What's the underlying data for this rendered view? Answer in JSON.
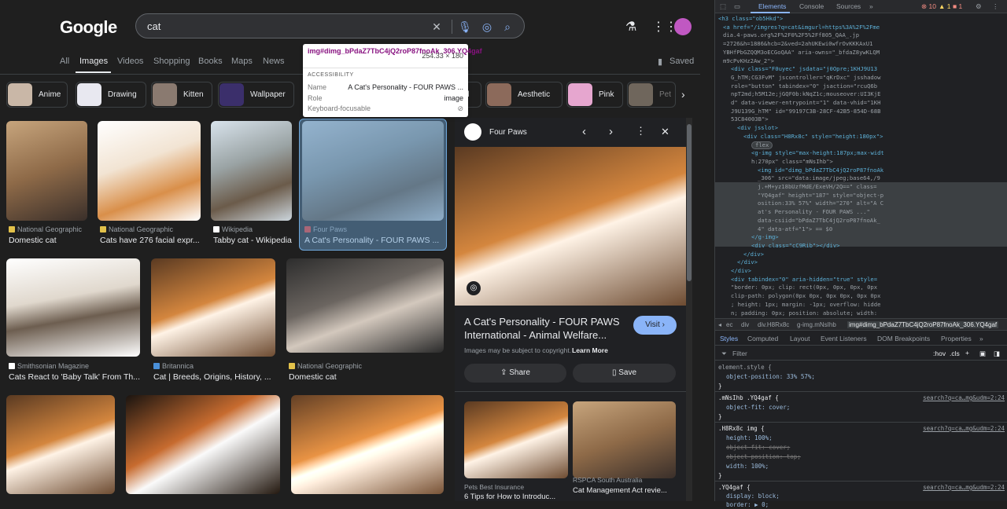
{
  "header": {
    "logo": "Google",
    "search_query": "cat",
    "saved_label": "Saved"
  },
  "tabs": [
    "All",
    "Images",
    "Videos",
    "Shopping",
    "Books",
    "Maps",
    "News"
  ],
  "chips": [
    "Anime",
    "Drawing",
    "Kitten",
    "Wallpaper",
    "rl",
    "Aesthetic",
    "Pink",
    "Pet"
  ],
  "results": [
    {
      "source": "National Geographic",
      "title": "Domestic cat"
    },
    {
      "source": "National Geographic",
      "title": "Cats have 276 facial expr..."
    },
    {
      "source": "Wikipedia",
      "title": "Tabby cat - Wikipedia"
    },
    {
      "source": "Four Paws",
      "title": "A Cat's Personality - FOUR PAWS ..."
    },
    {
      "source": "Smithsonian Magazine",
      "title": "Cats React to 'Baby Talk' From Th..."
    },
    {
      "source": "Britannica",
      "title": "Cat | Breeds, Origins, History, ..."
    },
    {
      "source": "National Geographic",
      "title": "Domestic cat"
    }
  ],
  "panel": {
    "source": "Four Paws",
    "title": "A Cat's Personality - FOUR PAWS International - Animal Welfare...",
    "visit_label": "Visit",
    "copyright": "Images may be subject to copyright.",
    "learn_more": "Learn More",
    "share_label": "Share",
    "save_label": "Save",
    "related": [
      {
        "source": "Pets Best Insurance",
        "title": "6 Tips for How to Introduc..."
      },
      {
        "source": "RSPCA South Australia",
        "title": "Cat Management Act revie..."
      }
    ]
  },
  "tooltip": {
    "selector": "img#dimg_bPdaZ7TbC4jQ2roP87fnoAk_306.YQ4gaf",
    "size": "254.33 × 180",
    "heading": "ACCESSIBILITY",
    "name_label": "Name",
    "name_value": "A Cat's Personality - FOUR PAWS ...",
    "role_label": "Role",
    "role_value": "image",
    "focus_label": "Keyboard-focusable"
  },
  "devtools": {
    "tabs": [
      "Elements",
      "Console",
      "Sources"
    ],
    "errors": "10",
    "warnings": "1",
    "issues": "1",
    "crumbs": [
      "ec",
      "div",
      "div.H8Rx8c",
      "g-img.mNsIhb",
      "img#dimg_bPdaZ7TbC4jQ2roP87fnoAk_306.YQ4gaf"
    ],
    "style_tabs": [
      "Styles",
      "Computed",
      "Layout",
      "Event Listeners",
      "DOM Breakpoints",
      "Properties"
    ],
    "filter_placeholder": "Filter",
    "hov": ":hov",
    "cls": ".cls",
    "code_lines": [
      "<h3 class=\"ob5Hkd\">",
      "<a href=\"/imgres?q=cat&imgurl=https%3A%2F%2Fme",
      "dia.4-paws.org%2F%2F0%2F5%2Ff805_QAA_.jp",
      "=2726&h=1886&hcb=2&ved=2ahUKEwi0wfrOvKKKAxU1",
      "YBHfPbGZQQM3oECGoQAA\" aria-owns=\"_bfdaZ8ywKLQM",
      "m9cPvKHz2Aw_2\">",
      "<div class=\"F0uyec\" jsdata=\"j0Opre;1KHJ9U13",
      "G_hTM;CG3FvM\" jscontroller=\"qKrDxc\" jsshadow",
      "role=\"button\" tabindex=\"0\" jsaction=\"rcuQ6b",
      "npT2md;h5M12e;jGQF0b:kNqZ1c;mouseover:UI3KjE",
      "d\" data-viewer-entrypoint=\"1\" data-vhid=\"1KH",
      "J9U139G_hTM\" id=\"99197C3B-28CF-42B5-854D-68B",
      "53C84003B\">",
      "<div jsslot>",
      "<div class=\"H8Rx8c\" style=\"height:180px\">",
      "flex",
      "<g-img style=\"max-height:187px;max-widt",
      "h:270px\" class=\"mNsIhb\">",
      "<img id=\"dimg_bPdaZ7TbC4jQ2roP87fnoAk",
      "_306\" src=\"data:image/jpeg;base64,/9",
      "j.+M+yz18bUzfMdE/ExeVH/2Q==\" class=",
      "\"YQ4gaf\" height=\"187\" style=\"object-p",
      "osition:33% 57%\" width=\"270\" alt=\"A C",
      "at's Personality - FOUR PAWS ...\"",
      "data-csiid=\"bPdaZ7TbC4jQ2roP87fnoAk_",
      "4\" data-atf=\"1\"> == $0",
      "</g-img>",
      "<div class=\"cC9Rib\"></div>",
      "</div>",
      "</div>",
      "</div>",
      "<div tabindex=\"0\" aria-hidden=\"true\" style=",
      "\"border: 0px; clip: rect(0px, 0px, 0px, 0px",
      "clip-path: polygon(0px 0px, 0px 0px, 0px 0px",
      "; height: 1px; margin: -1px; overflow: hidde",
      "n; padding: 0px; position: absolute; width:"
    ],
    "rules": [
      "element.style {",
      "object-position: 33% 57%;",
      "}",
      ".mNsIhb .YQ4gaf {",
      "object-fit: cover;",
      "}",
      ".H8Rx8c img {",
      "height: 100%;",
      "object-fit: cover;",
      "object-position: top;",
      "width: 100%;",
      "}",
      ".YQ4gaf {",
      "display: block;",
      "border: ▶ 0;"
    ],
    "rule_source": "search?q=ca…mg&udm=2:24"
  }
}
